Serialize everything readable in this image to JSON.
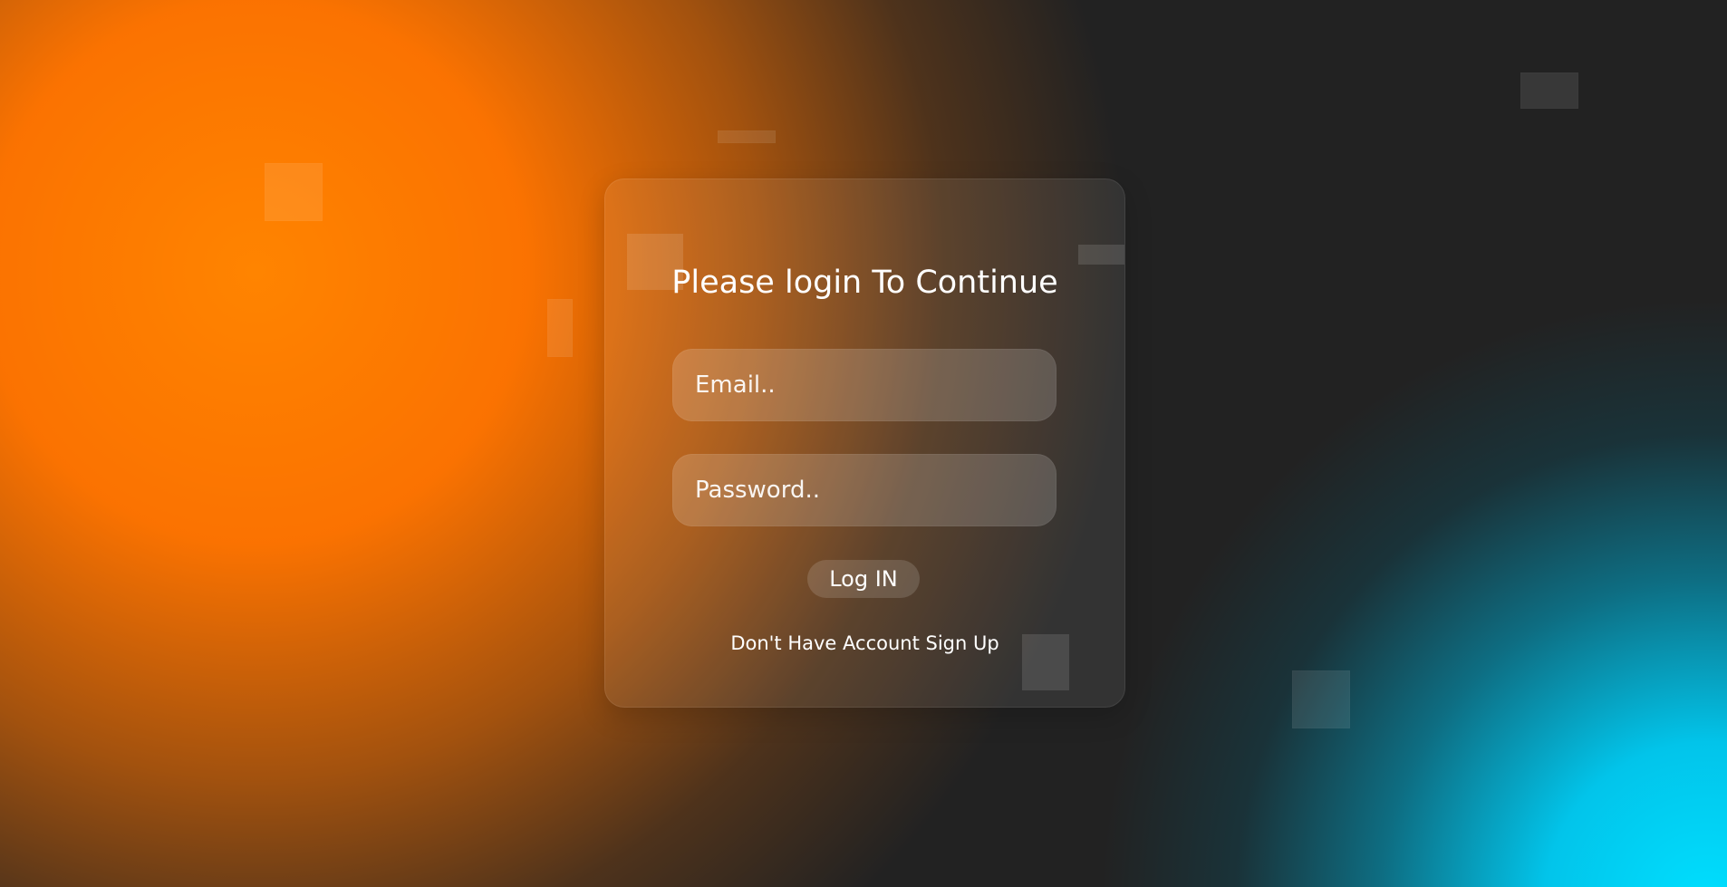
{
  "login": {
    "title": "Please login To Continue",
    "email_placeholder": "Email..",
    "password_placeholder": "Password..",
    "button_label": "Log IN",
    "signup_text": "Don't Have Account Sign Up"
  },
  "theme": {
    "orange": "#ff7a00",
    "teal": "#00d8ff",
    "dark": "#222222"
  }
}
